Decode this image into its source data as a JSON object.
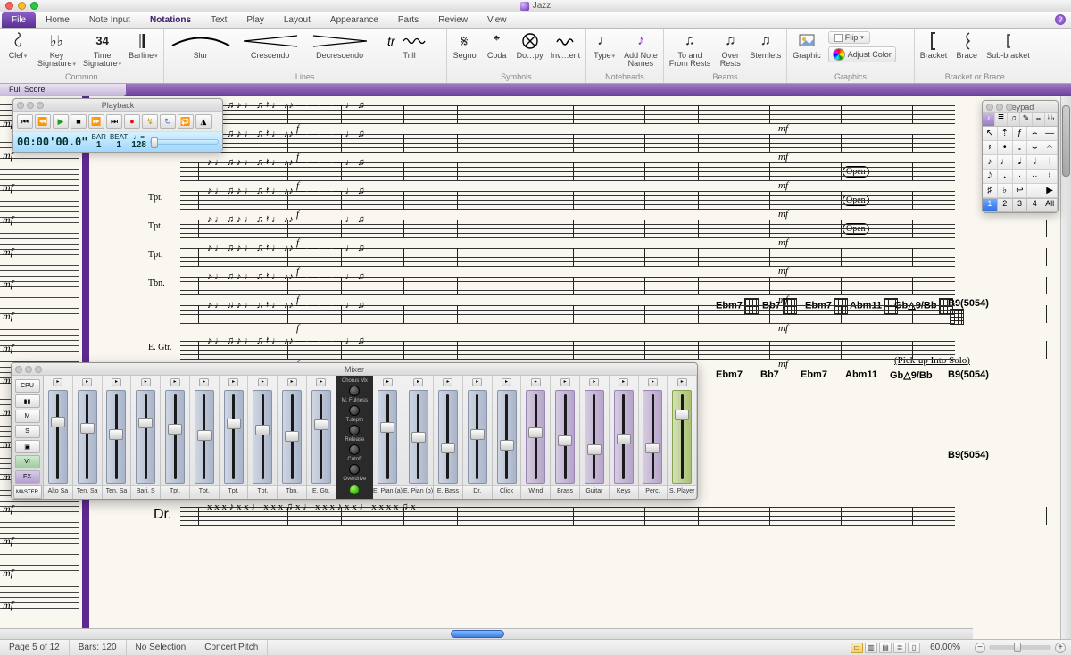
{
  "title": "Jazz",
  "tabs": [
    "File",
    "Home",
    "Note Input",
    "Notations",
    "Text",
    "Play",
    "Layout",
    "Appearance",
    "Parts",
    "Review",
    "View"
  ],
  "activeTab": "Notations",
  "docTab": "Full Score",
  "ribbon": {
    "common": {
      "label": "Common",
      "clef": "Clef",
      "key": "Key\nSignature",
      "time": "Time\nSignature",
      "barline": "Barline"
    },
    "lines": {
      "label": "Lines",
      "slur": "Slur",
      "cresc": "Crescendo",
      "decresc": "Decrescendo",
      "trill": "Trill"
    },
    "symbols": {
      "label": "Symbols",
      "segno": "Segno",
      "coda": "Coda",
      "dorep": "Do…py",
      "invent": "Inv…ent"
    },
    "noteheads": {
      "label": "Noteheads",
      "type": "Type",
      "addnames": "Add Note\nNames"
    },
    "beams": {
      "label": "Beams",
      "tofrom": "To and\nFrom Rests",
      "over": "Over\nRests",
      "stemlets": "Stemlets"
    },
    "graphics": {
      "label": "Graphics",
      "graphic": "Graphic",
      "flip": "Flip",
      "adjust": "Adjust Color"
    },
    "brace": {
      "label": "Bracket or Brace",
      "bracket": "Bracket",
      "brace": "Brace",
      "sub": "Sub-bracket"
    }
  },
  "playback": {
    "title": "Playback",
    "time": "00:00'00.0\"",
    "barL": "BAR",
    "bar": "1",
    "beatL": "BEAT",
    "beat": "1",
    "tempoL": "♩=",
    "tempo": "128"
  },
  "keypad": {
    "title": "Keypad",
    "foot": [
      "1",
      "2",
      "3",
      "4",
      "All"
    ],
    "glyphs": [
      "↖",
      "⇡",
      "ƒ",
      "⌢",
      "—",
      "𝄽",
      "•",
      "𝅗",
      "⌣",
      "𝄐",
      "♪",
      "♩",
      "𝅘𝅥",
      "𝅗𝅥",
      "𝄀",
      "𝅘𝅥𝅮",
      "𝆺",
      "·",
      "··",
      "♮",
      "♯",
      "♭",
      "↩",
      "",
      "▶"
    ]
  },
  "mixer": {
    "title": "Mixer",
    "side": [
      "CPU",
      "▮▮",
      "M",
      "S",
      "▣",
      "VI",
      "FX",
      "MASTER"
    ],
    "tracks": [
      "Alto Sa",
      "Ten. Sa",
      "Ten. Sa",
      "Bari. S",
      "Tpt.",
      "Tpt.",
      "Tpt.",
      "Tpt.",
      "Tbn.",
      "E. Gtr."
    ],
    "tracks2": [
      "E. Pian (a)",
      "E. Pian (b)",
      "E. Bass",
      "Dr.",
      "Click"
    ],
    "groups": [
      "Wind",
      "Brass",
      "Guitar",
      "Keys",
      "Perc."
    ],
    "splayer": "S. Player",
    "fx": [
      "Chorus Mx",
      "M. Fulness",
      "T.depth",
      "Release",
      "Cutoff",
      "Overdrive"
    ]
  },
  "score": {
    "mf": "mf",
    "f": "f",
    "insts": [
      "Tpt.",
      "Tpt.",
      "Tpt.",
      "Tbn."
    ],
    "egtr": "E. Gtr.",
    "dr": "Dr.",
    "open": "Open",
    "chords": [
      "Ebm7",
      "Bb7",
      "Ebm7",
      "Abm11",
      "Gb△9/Bb",
      "B9(5054)"
    ],
    "chordsRow2": [
      "Ebm7",
      "Bb7",
      "Ebm7",
      "Abm11",
      "Gb△9/Bb",
      "B9(5054)"
    ],
    "chordB3": "B9(5054)",
    "pickup": "(Pick-up Into Solo)"
  },
  "status": {
    "page": "Page 5 of 12",
    "bars": "Bars: 120",
    "sel": "No Selection",
    "pitch": "Concert Pitch",
    "zoom": "60.00%"
  }
}
